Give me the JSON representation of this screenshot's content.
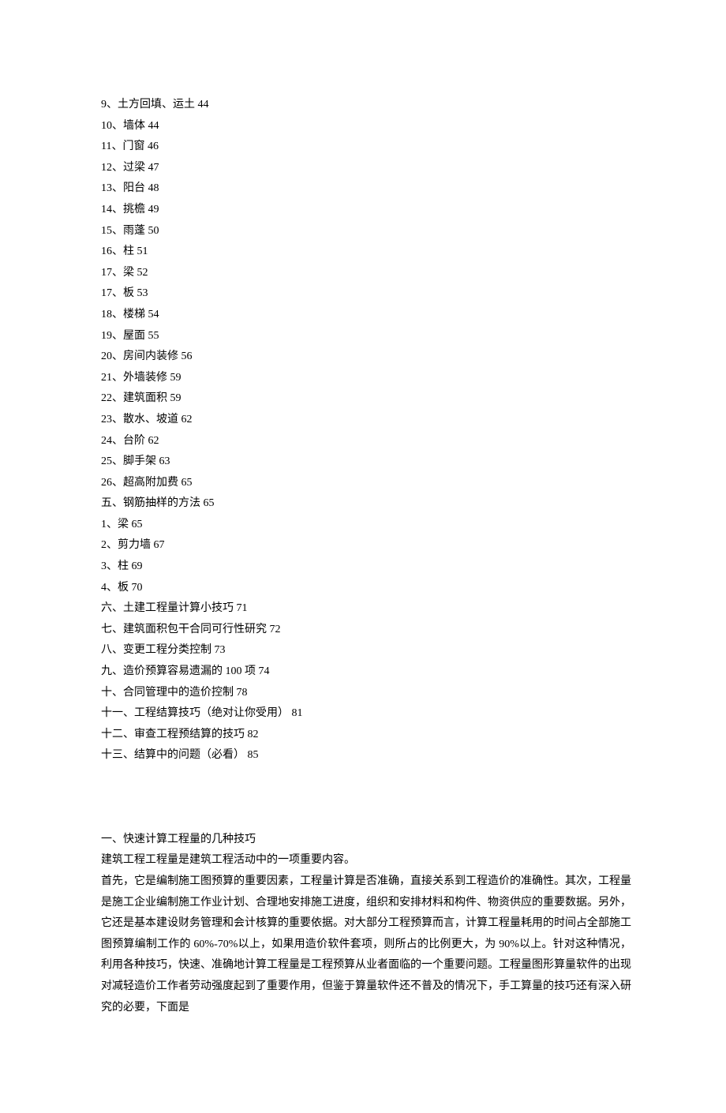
{
  "toc_lines": [
    "9、土方回填、运土 44",
    "10、墙体 44",
    "11、门窗 46",
    "12、过梁 47",
    "13、阳台 48",
    "14、挑檐 49",
    "15、雨蓬 50",
    "16、柱 51",
    "17、梁 52",
    "17、板 53",
    "18、楼梯 54",
    "19、屋面 55",
    "20、房间内装修 56",
    "21、外墙装修 59",
    "22、建筑面积 59",
    "23、散水、坡道 62",
    "24、台阶 62",
    "25、脚手架 63",
    "26、超高附加费 65",
    "五、钢筋抽样的方法 65",
    "1、梁 65",
    "2、剪力墙 67",
    "3、柱 69",
    "4、板 70",
    "六、土建工程量计算小技巧 71",
    "七、建筑面积包干合同可行性研究 72",
    "八、变更工程分类控制 73",
    "九、造价预算容易遗漏的 100 项 74",
    "十、合同管理中的造价控制 78",
    "十一、工程结算技巧（绝对让你受用） 81",
    "十二、审查工程预结算的技巧 82",
    "十三、结算中的问题（必看） 85"
  ],
  "section": {
    "heading": "一、快速计算工程量的几种技巧",
    "line1": "建筑工程工程量是建筑工程活动中的一项重要内容。",
    "body": "首先，它是编制施工图预算的重要因素，工程量计算是否准确，直接关系到工程造价的准确性。其次，工程量是施工企业编制施工作业计划、合理地安排施工进度，组织和安排材料和构件、物资供应的重要数据。另外，它还是基本建设财务管理和会计核算的重要依据。对大部分工程预算而言，计算工程量耗用的时间占全部施工图预算编制工作的 60%-70%以上，如果用造价软件套项，则所占的比例更大，为 90%以上。针对这种情况，利用各种技巧，快速、准确地计算工程量是工程预算从业者面临的一个重要问题。工程量图形算量软件的出现对减轻造价工作者劳动强度起到了重要作用，但鉴于算量软件还不普及的情况下，手工算量的技巧还有深入研究的必要，下面是"
  }
}
